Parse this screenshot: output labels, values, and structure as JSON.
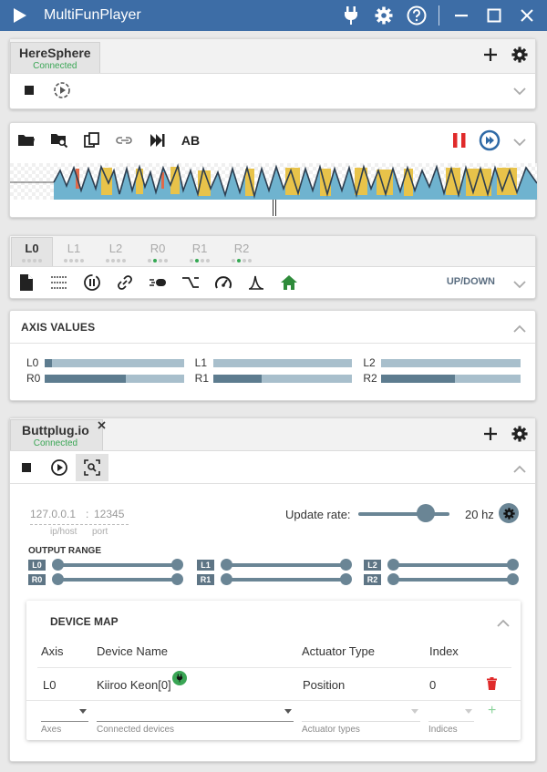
{
  "window": {
    "title": "MultiFunPlayer",
    "accent": "#3d6da6"
  },
  "video_source": {
    "tab_name": "HereSphere",
    "tab_status": "Connected"
  },
  "script": {
    "ab_label": "AB"
  },
  "axis_tabs": [
    {
      "label": "L0",
      "active": true
    },
    {
      "label": "L1",
      "active": false
    },
    {
      "label": "L2",
      "active": false
    },
    {
      "label": "R0",
      "active": false
    },
    {
      "label": "R1",
      "active": false
    },
    {
      "label": "R2",
      "active": false
    }
  ],
  "axis_toolbar": {
    "mode_label": "UP/DOWN"
  },
  "axis_values": {
    "title": "AXIS VALUES",
    "axes": [
      {
        "label": "L0",
        "value": 0.05
      },
      {
        "label": "L1",
        "value": 0.0
      },
      {
        "label": "L2",
        "value": 0.0
      },
      {
        "label": "R0",
        "value": 0.58
      },
      {
        "label": "R1",
        "value": 0.35
      },
      {
        "label": "R2",
        "value": 0.53
      }
    ]
  },
  "output": {
    "tab_name": "Buttplug.io",
    "tab_status": "Connected",
    "ip": "127.0.0.1",
    "port": "12345",
    "ip_hint": "ip/host",
    "port_hint": "port",
    "update_rate_label": "Update rate:",
    "update_rate_value": "20 hz",
    "output_range_title": "OUTPUT RANGE",
    "range_tags": [
      "L0",
      "R0",
      "L1",
      "R1",
      "L2",
      "R2"
    ]
  },
  "device_map": {
    "title": "DEVICE MAP",
    "columns": [
      "Axis",
      "Device Name",
      "Actuator Type",
      "Index"
    ],
    "rows": [
      {
        "axis": "L0",
        "device": "Kiiroo Keon[0]",
        "actuator": "Position",
        "index": "0"
      }
    ],
    "add_labels": [
      "Axes",
      "Connected devices",
      "Actuator types",
      "Indices"
    ],
    "add_symbol": "+"
  }
}
